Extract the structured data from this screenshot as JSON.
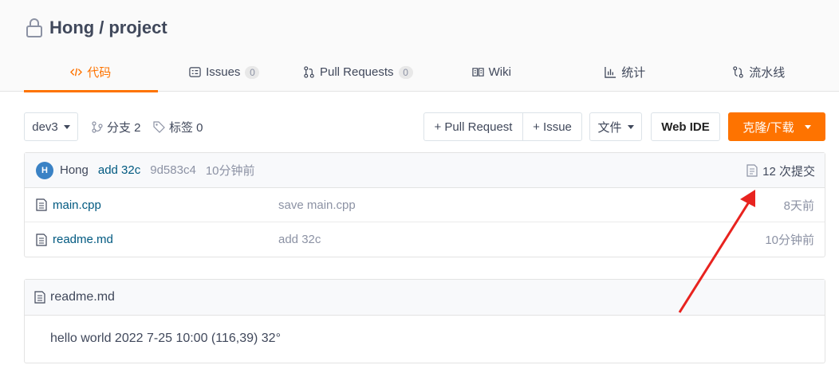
{
  "repo": {
    "owner": "Hong",
    "separator": "/",
    "name": "project"
  },
  "tabs": [
    {
      "label": "代码",
      "icon": "code-icon"
    },
    {
      "label": "Issues",
      "badge": "0",
      "icon": "issues-icon"
    },
    {
      "label": "Pull Requests",
      "badge": "0",
      "icon": "pull-request-icon"
    },
    {
      "label": "Wiki",
      "icon": "wiki-icon"
    },
    {
      "label": "统计",
      "icon": "stats-icon"
    },
    {
      "label": "流水线",
      "icon": "pipeline-icon"
    }
  ],
  "toolbar": {
    "branch": "dev3",
    "branches_label": "分支 2",
    "tags_label": "标签 0",
    "new_pr": "+ Pull Request",
    "new_issue": "+ Issue",
    "file_menu": "文件",
    "web_ide": "Web IDE",
    "clone": "克隆/下载"
  },
  "commit": {
    "avatar": "H",
    "author": "Hong",
    "message": "add 32c",
    "sha": "9d583c4",
    "time": "10分钟前",
    "count": "12 次提交"
  },
  "files": [
    {
      "name": "main.cpp",
      "message": "save main.cpp",
      "time": "8天前"
    },
    {
      "name": "readme.md",
      "message": "add 32c",
      "time": "10分钟前"
    }
  ],
  "readme": {
    "title": "readme.md",
    "content": "hello world 2022 7-25 10:00 (116,39) 32°"
  },
  "colors": {
    "accent": "#fe7300",
    "link": "#005980",
    "muted": "#8c92a4",
    "annotation": "#e8231f"
  }
}
